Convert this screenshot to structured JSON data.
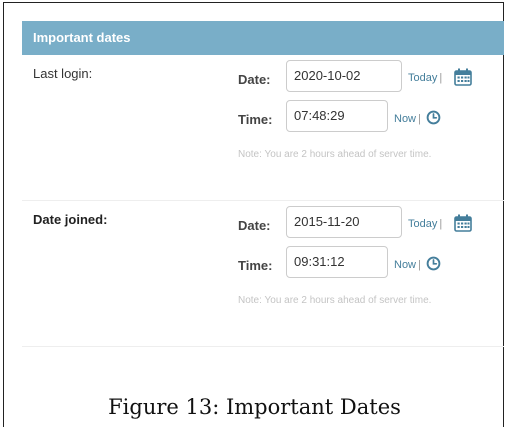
{
  "module": {
    "title": "Important dates"
  },
  "fields": [
    {
      "label": "Last login:",
      "date_label": "Date:",
      "date_value": "2020-10-02",
      "today_link": "Today",
      "time_label": "Time:",
      "time_value": "07:48:29",
      "now_link": "Now",
      "separator": "|",
      "help": "Note: You are 2 hours ahead of server time.",
      "calendar_icon": "calendar-icon",
      "clock_icon": "clock-icon"
    },
    {
      "label": "Date joined:",
      "date_label": "Date:",
      "date_value": "2015-11-20",
      "today_link": "Today",
      "time_label": "Time:",
      "time_value": "09:31:12",
      "now_link": "Now",
      "separator": "|",
      "help": "Note: You are 2 hours ahead of server time.",
      "calendar_icon": "calendar-icon",
      "clock_icon": "clock-icon"
    }
  ],
  "colors": {
    "header_bg": "#79aec8",
    "link": "#447e9b",
    "help_text": "#c4c4c4"
  },
  "caption": "Figure 13: Important Dates"
}
